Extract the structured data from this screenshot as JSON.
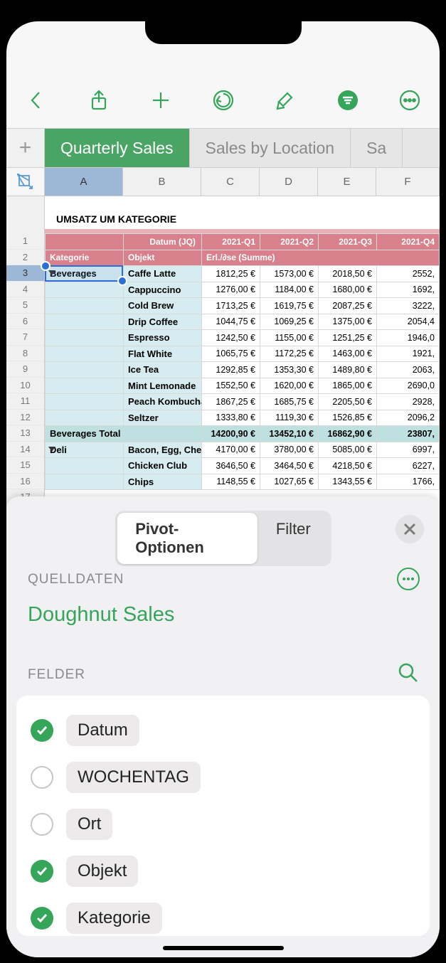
{
  "toolbar": {
    "back": "back",
    "share": "share",
    "add": "add",
    "undo": "undo",
    "brush": "format",
    "filter": "filter",
    "more": "more"
  },
  "tabs": [
    {
      "label": "Quarterly Sales",
      "active": true
    },
    {
      "label": "Sales by Location",
      "active": false
    },
    {
      "label": "Sa",
      "active": false
    }
  ],
  "columns": [
    "A",
    "B",
    "C",
    "D",
    "E",
    "F"
  ],
  "sheet": {
    "title": "UMSATZ UM KATEGORIE",
    "hdr1": {
      "datum": "Datum (JQ)",
      "q": [
        "2021-Q1",
        "2021-Q2",
        "2021-Q3",
        "2021-Q4"
      ]
    },
    "hdr2": {
      "kat": "Kategorie",
      "obj": "Objekt",
      "erl": "Erl./∂se (Summe)"
    },
    "rows": [
      {
        "n": 3,
        "cat": "Beverages",
        "obj": "Caffe Latte",
        "v": [
          "1812,25 €",
          "1573,00 €",
          "2018,50 €",
          "2552,"
        ],
        "catfirst": true,
        "sel": true
      },
      {
        "n": 4,
        "obj": "Cappuccino",
        "v": [
          "1276,00 €",
          "1184,00 €",
          "1680,00 €",
          "1692,"
        ]
      },
      {
        "n": 5,
        "obj": "Cold Brew",
        "v": [
          "1713,25 €",
          "1619,75 €",
          "2087,25 €",
          "3222,"
        ]
      },
      {
        "n": 6,
        "obj": "Drip Coffee",
        "v": [
          "1044,75 €",
          "1069,25 €",
          "1375,00 €",
          "2054,4"
        ]
      },
      {
        "n": 7,
        "obj": "Espresso",
        "v": [
          "1242,50 €",
          "1155,00 €",
          "1251,25 €",
          "1946,0"
        ]
      },
      {
        "n": 8,
        "obj": "Flat White",
        "v": [
          "1065,75 €",
          "1172,25 €",
          "1463,00 €",
          "1921,"
        ]
      },
      {
        "n": 9,
        "obj": "Ice Tea",
        "v": [
          "1292,85 €",
          "1353,30 €",
          "1489,80 €",
          "2063,"
        ]
      },
      {
        "n": 10,
        "obj": "Mint Lemonade",
        "v": [
          "1552,50 €",
          "1620,00 €",
          "1865,00 €",
          "2690,0"
        ]
      },
      {
        "n": 11,
        "obj": "Peach Kombucha",
        "v": [
          "1867,25 €",
          "1685,75 €",
          "2205,50 €",
          "2928,"
        ]
      },
      {
        "n": 12,
        "obj": "Seltzer",
        "v": [
          "1333,80 €",
          "1119,30 €",
          "1526,85 €",
          "2096,2"
        ]
      }
    ],
    "total": {
      "n": 13,
      "label": "Beverages Total",
      "v": [
        "14200,90 €",
        "13452,10 €",
        "16862,90 €",
        "23807,"
      ]
    },
    "deli": [
      {
        "n": 14,
        "cat": "Deli",
        "obj": "Bacon, Egg, Cheese",
        "v": [
          "4170,00 €",
          "3780,00 €",
          "5085,00 €",
          "6997,"
        ],
        "catfirst": true
      },
      {
        "n": 15,
        "obj": "Chicken Club",
        "v": [
          "3646,50 €",
          "3464,50 €",
          "4218,50 €",
          "6227,"
        ]
      },
      {
        "n": 16,
        "obj": "Chips",
        "v": [
          "1148,55 €",
          "1027,65 €",
          "1343,55 €",
          "1766,"
        ]
      }
    ],
    "rownums_pre": [
      1,
      2
    ]
  },
  "panel": {
    "seg": {
      "pivot": "Pivot-Optionen",
      "filter": "Filter"
    },
    "quelldaten": "QUELLDATEN",
    "source": "Doughnut Sales",
    "felder": "FELDER",
    "fields": [
      {
        "label": "Datum",
        "on": true
      },
      {
        "label": "WOCHENTAG",
        "on": false
      },
      {
        "label": "Ort",
        "on": false
      },
      {
        "label": "Objekt",
        "on": true
      },
      {
        "label": "Kategorie",
        "on": true
      }
    ]
  }
}
